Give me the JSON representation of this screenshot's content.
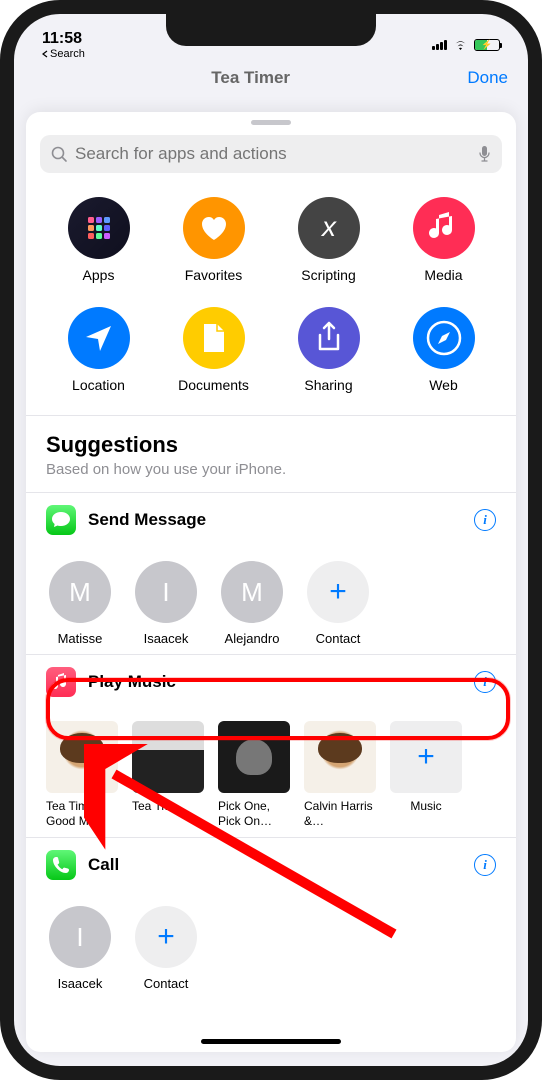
{
  "status": {
    "time": "11:58",
    "back_label": "Search"
  },
  "nav": {
    "title": "Tea Timer",
    "done": "Done"
  },
  "search": {
    "placeholder": "Search for apps and actions"
  },
  "categories": [
    {
      "label": "Apps"
    },
    {
      "label": "Favorites"
    },
    {
      "label": "Scripting"
    },
    {
      "label": "Media"
    },
    {
      "label": "Location"
    },
    {
      "label": "Documents"
    },
    {
      "label": "Sharing"
    },
    {
      "label": "Web"
    }
  ],
  "suggestions": {
    "title": "Suggestions",
    "subtitle": "Based on how you use your iPhone."
  },
  "sections": {
    "send_message": {
      "title": "Send Message",
      "contacts": [
        {
          "initial": "M",
          "name": "Matisse"
        },
        {
          "initial": "I",
          "name": "Isaacek"
        },
        {
          "initial": "M",
          "name": "Alejandro"
        }
      ],
      "add_label": "Contact"
    },
    "play_music": {
      "title": "Play Music",
      "items": [
        {
          "name": "Tea Time, Good M…"
        },
        {
          "name": "Tea Ti…"
        },
        {
          "name": "Pick One, Pick On…"
        },
        {
          "name": "Calvin Harris &…"
        }
      ],
      "add_label": "Music"
    },
    "call": {
      "title": "Call",
      "contacts": [
        {
          "initial": "I",
          "name": "Isaacek"
        }
      ],
      "add_label": "Contact"
    }
  }
}
